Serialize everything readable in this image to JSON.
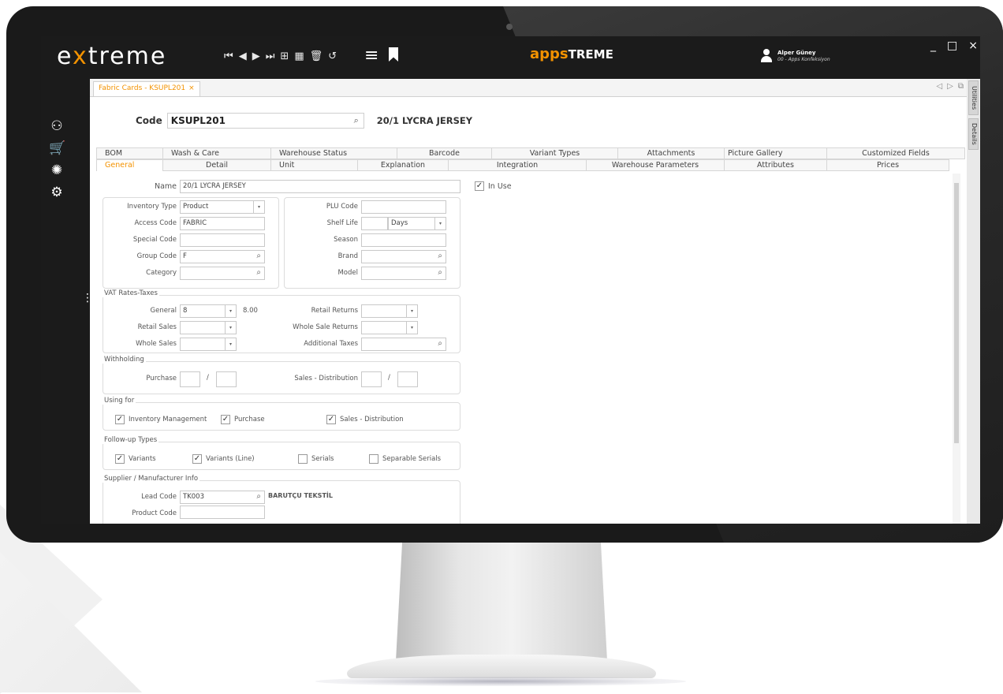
{
  "app": {
    "logo_prefix": "e",
    "logo_x": "x",
    "logo_rest": "treme",
    "brand_apps": "apps",
    "brand_treme": "TREME",
    "user_name": "Alper Güney",
    "user_role": "00 - Apps Konfeksiyon",
    "win_min": "_",
    "win_max": "□",
    "win_close": "×",
    "nav": {
      "first": "⏮",
      "prev": "◀",
      "next": "▶",
      "last": "⏭",
      "new": "⊞",
      "save": "▦",
      "delete": "🗑",
      "undo": "↺",
      "menu": "≡"
    }
  },
  "sidebar": {
    "icons": [
      "forklift-icon",
      "cart-icon",
      "network-icon",
      "gear-icon"
    ],
    "glyphs": [
      "⚇",
      "🛒",
      "✺",
      "⚙"
    ],
    "dots": "⋮"
  },
  "utilities": {
    "tab1": "Utilities",
    "tab2": "Details"
  },
  "doc_tab": {
    "label": "Fabric Cards - KSUPL201",
    "close": "×",
    "nav_prev": "◁",
    "nav_next": "▷",
    "nav_restore": "⧉"
  },
  "code": {
    "label": "Code",
    "value": "KSUPL201",
    "description": "20/1 LYCRA JERSEY"
  },
  "tabs_top": [
    "BOM",
    "Wash & Care",
    "Warehouse Status",
    "Barcode",
    "Variant Types",
    "Attachments",
    "Picture Gallery",
    "Customized Fields"
  ],
  "tabs_bottom": [
    "General",
    "Detail",
    "Unit",
    "Explanation",
    "Integration",
    "Warehouse Parameters",
    "Attributes",
    "Prices"
  ],
  "form": {
    "name_label": "Name",
    "name_value": "20/1 LYCRA JERSEY",
    "in_use_label": "In Use",
    "inventory_type_label": "Inventory Type",
    "inventory_type_value": "Product",
    "access_code_label": "Access Code",
    "access_code_value": "FABRIC",
    "special_code_label": "Special Code",
    "group_code_label": "Group Code",
    "group_code_value": "F",
    "category_label": "Category",
    "plu_code_label": "PLU Code",
    "shelf_life_label": "Shelf Life",
    "shelf_life_unit": "Days",
    "season_label": "Season",
    "brand_label": "Brand",
    "model_label": "Model",
    "vat_title": "VAT Rates-Taxes",
    "vat_general_label": "General",
    "vat_general_value": "8",
    "vat_general_rate": "8.00",
    "retail_sales_label": "Retail Sales",
    "whole_sales_label": "Whole Sales",
    "retail_returns_label": "Retail Returns",
    "whole_sale_returns_label": "Whole Sale Returns",
    "additional_taxes_label": "Additional Taxes",
    "withholding_title": "Withholding",
    "purchase_label": "Purchase",
    "slash": "/",
    "sales_distribution_label": "Sales - Distribution",
    "using_for_title": "Using for",
    "inventory_management_label": "Inventory Management",
    "purchase_chk_label": "Purchase",
    "sales_distribution_chk_label": "Sales - Distribution",
    "followup_title": "Follow-up Types",
    "variants_label": "Variants",
    "variants_line_label": "Variants (Line)",
    "serials_label": "Serials",
    "separable_serials_label": "Separable Serials",
    "supplier_title": "Supplier / Manufacturer Info",
    "lead_code_label": "Lead Code",
    "lead_code_value": "TK003",
    "lead_code_name": "BARUTÇU TEKSTİL",
    "product_code_label": "Product Code",
    "check_mark": "✓",
    "dropdown_arrow": "▾",
    "search_glyph": "⌕"
  }
}
